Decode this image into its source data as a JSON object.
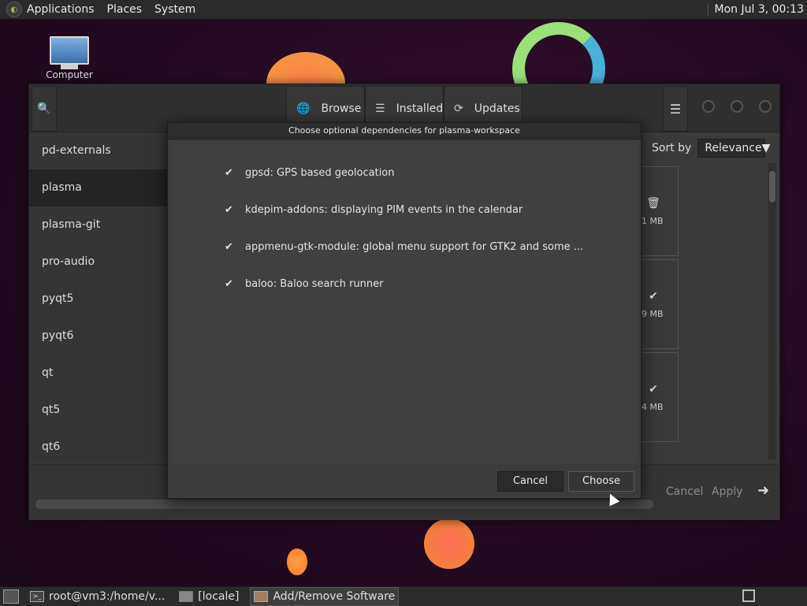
{
  "top_panel": {
    "menus": [
      "Applications",
      "Places",
      "System"
    ],
    "clock": "Mon Jul  3, 00:13"
  },
  "desktop": {
    "icon_label": "Computer"
  },
  "window": {
    "tabs": [
      {
        "icon": "globe-icon",
        "glyph": "🌐",
        "label": "Browse"
      },
      {
        "icon": "list-icon",
        "glyph": "☰",
        "label": "Installed"
      },
      {
        "icon": "refresh-icon",
        "glyph": "⟳",
        "label": "Updates"
      }
    ],
    "sidebar": [
      {
        "label": "pd-externals",
        "selected": false
      },
      {
        "label": "plasma",
        "selected": true
      },
      {
        "label": "plasma-git",
        "selected": false
      },
      {
        "label": "pro-audio",
        "selected": false
      },
      {
        "label": "pyqt5",
        "selected": false
      },
      {
        "label": "pyqt6",
        "selected": false
      },
      {
        "label": "qt",
        "selected": false
      },
      {
        "label": "qt5",
        "selected": false
      },
      {
        "label": "qt6",
        "selected": false
      }
    ],
    "sort": {
      "label": "Sort by",
      "value": "Relevance"
    },
    "cards": [
      {
        "icon": "trash-icon",
        "glyph": "🗑",
        "size": "1 MB"
      },
      {
        "icon": "check-icon",
        "glyph": "✔",
        "size": "9 MB"
      },
      {
        "icon": "check-icon",
        "glyph": "✔",
        "size": "4 MB"
      }
    ],
    "bottom": {
      "cancel": "Cancel",
      "apply": "Apply",
      "next_glyph": "➜"
    }
  },
  "dialog": {
    "title": "Choose optional dependencies for plasma-workspace",
    "items": [
      {
        "checked": true,
        "text": "gpsd: GPS based geolocation"
      },
      {
        "checked": true,
        "text": "kdepim-addons: displaying PIM events in the calendar"
      },
      {
        "checked": true,
        "text": "appmenu-gtk-module: global menu support for GTK2 and some ..."
      },
      {
        "checked": true,
        "text": "baloo: Baloo search runner"
      }
    ],
    "cancel_label": "Cancel",
    "choose_label": "Choose"
  },
  "taskbar": {
    "tasks": [
      {
        "label": "root@vm3:/home/v...",
        "active": false
      },
      {
        "label": "[locale]",
        "active": false
      },
      {
        "label": "Add/Remove Software",
        "active": true
      }
    ]
  }
}
